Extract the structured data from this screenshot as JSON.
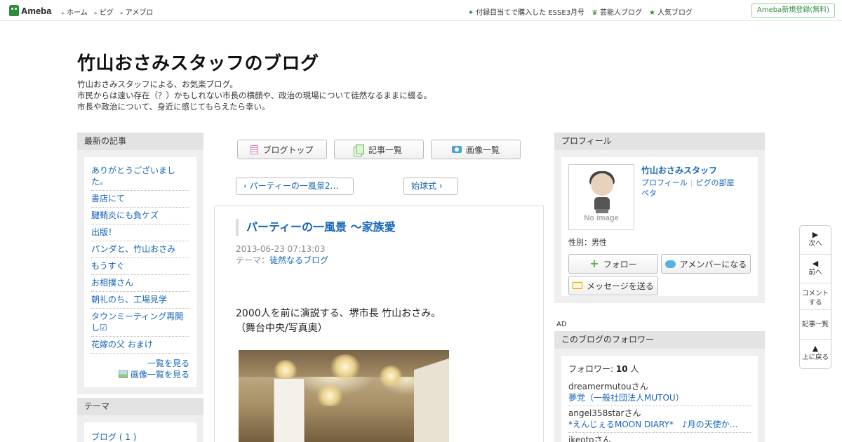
{
  "global_header": {
    "logo_text": "Ameba",
    "nav": [
      "ホーム",
      "ピグ",
      "アメブロ"
    ],
    "promo_text": "付録目当てで購入した ESSE3月号",
    "links": [
      "芸能人ブログ",
      "人気ブログ"
    ],
    "register_button": "Ameba新規登録(無料)",
    "accent_color": "#2d8c3c"
  },
  "blog": {
    "title": "竹山おさみスタッフのブログ",
    "description": [
      "竹山おさみスタッフによる、お気楽ブログ。",
      "市民からは遠い存在（？）かもしれない市長の横顔や、政治の現場について徒然なるままに綴る。",
      "市長や政治について、身近に感じてもらえたら幸い。"
    ]
  },
  "sidebar_left": {
    "recent_heading": "最新の記事",
    "recent_posts": [
      "ありがとうございました。",
      "書店にて",
      "腱鞘炎にも負ケズ",
      "出版！",
      "パンダと、竹山おさみ",
      "もうすぐ",
      "お相撲さん",
      "朝礼のち、工場見学",
      "タウンミーティング再開し☑",
      "花嫁の父 おまけ"
    ],
    "more_list": "一覧を見る",
    "more_images": "画像一覧を見る",
    "theme_heading": "テーマ",
    "theme_items": [
      "ブログ ( 1 )"
    ]
  },
  "toolbar": {
    "blog_top": "ブログトップ",
    "article_list": "記事一覧",
    "image_list": "画像一覧"
  },
  "pager": {
    "prev": "パーティーの一風景2…",
    "next": "始球式"
  },
  "article": {
    "title": "パーティーの一風景 〜家族愛",
    "date": "2013-06-23 07:13:03",
    "theme_label": "テーマ：",
    "theme_value": "徒然なるブログ",
    "body": [
      "2000人を前に演説する、堺市長 竹山おさみ。",
      "（舞台中央/写真奥）"
    ]
  },
  "profile": {
    "heading": "プロフィール",
    "name": "竹山おさみスタッフ",
    "links": [
      "プロフィール",
      "ピグの部屋",
      "ペタ"
    ],
    "avatar_text": "No image",
    "sex": "性別：男性",
    "follow_button": "フォロー",
    "amember_button": "アメンバーになる",
    "message_button": "メッセージを送る"
  },
  "ad_label": "AD",
  "followers": {
    "heading": "このブログのフォロワー",
    "count_label": "フォロワー:",
    "count": "10",
    "count_unit": "人",
    "items": [
      {
        "user": "dreamermutouさん",
        "blog": "夢党（一般社団法人MUTOU）"
      },
      {
        "user": "angel358starさん",
        "blog": "*えんじぇるMOON DIARY*　♪月の天使から…"
      },
      {
        "user": "ikeotoさん",
        "blog": ""
      }
    ]
  },
  "floating_nav": {
    "next": "次へ",
    "prev": "前へ",
    "comment": "コメントする",
    "article_list": "記事一覧",
    "to_top": "上に戻る"
  }
}
